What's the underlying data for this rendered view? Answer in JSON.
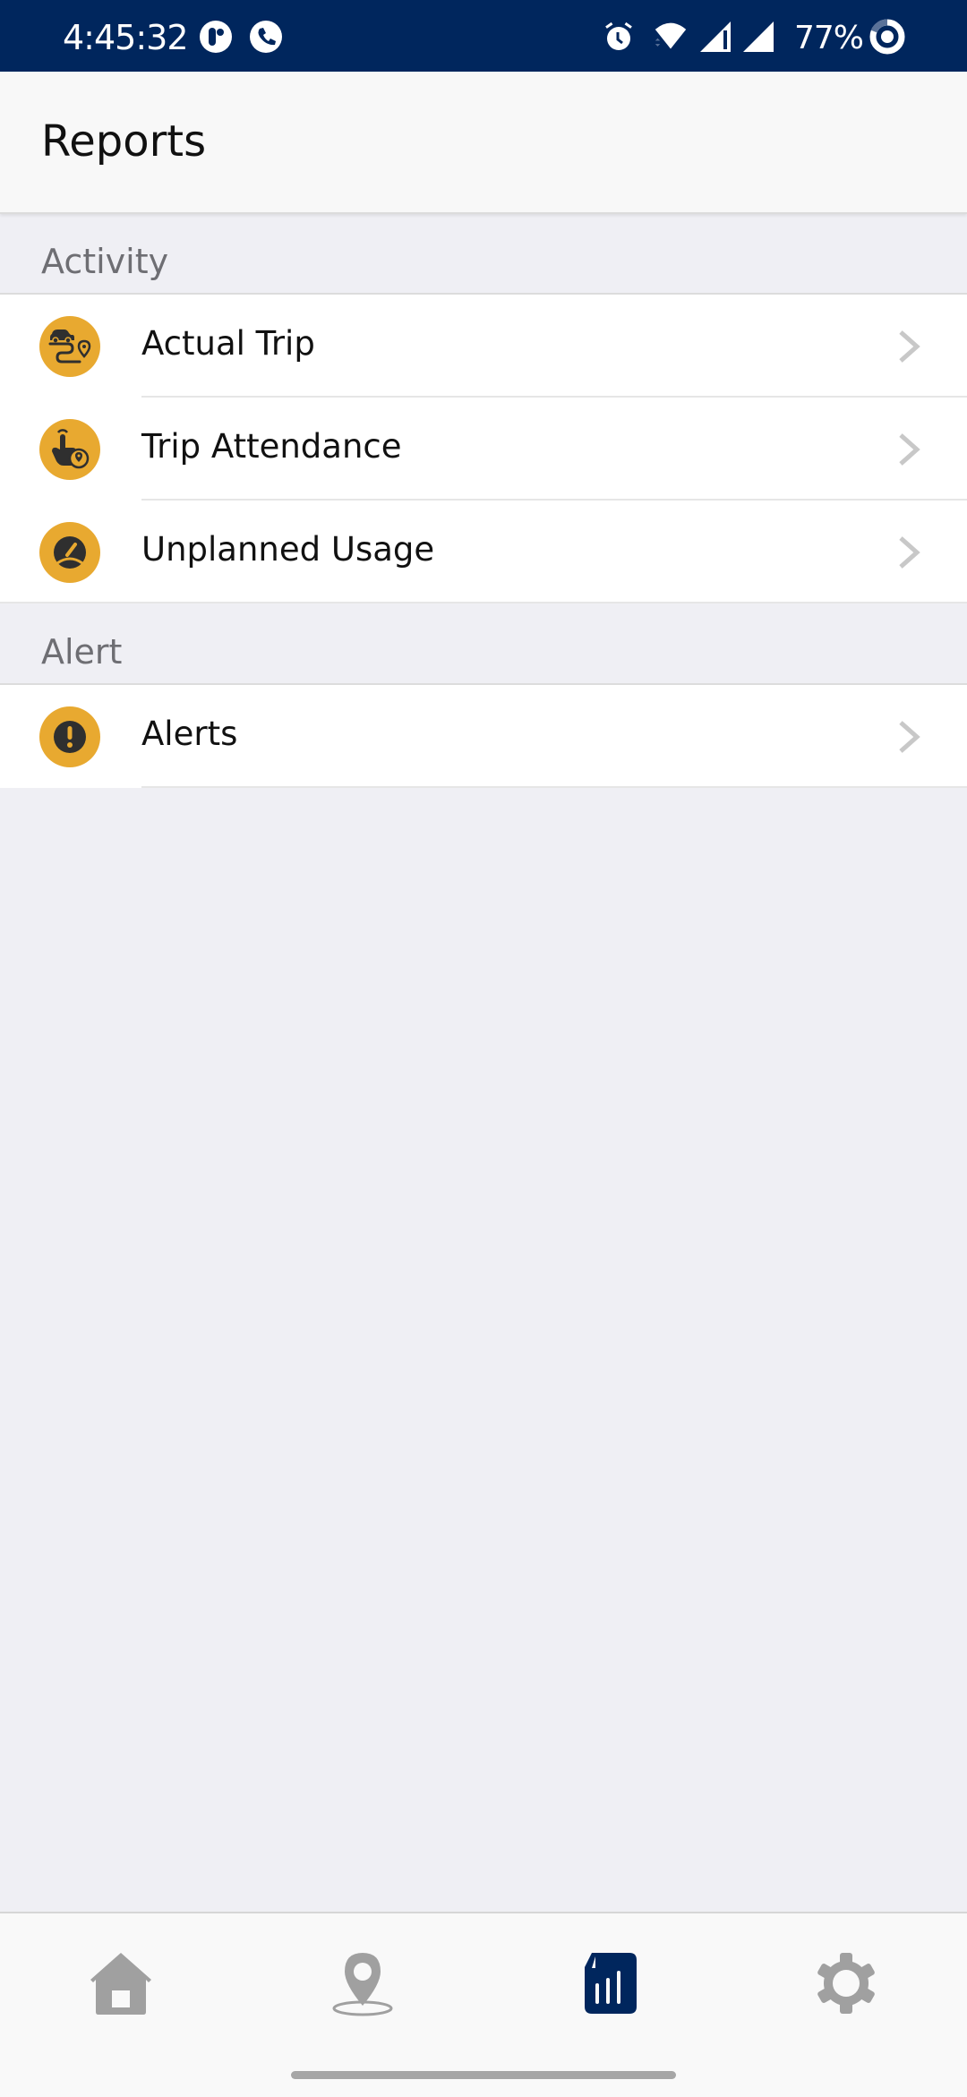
{
  "status_bar": {
    "time": "4:45:32",
    "battery_percent": "77%",
    "left_icons": [
      "app-notification-icon",
      "phone-call-icon"
    ],
    "right_icons": [
      "alarm-icon",
      "wifi-icon",
      "signal-icon",
      "signal-icon",
      "battery-saver-icon"
    ]
  },
  "header": {
    "title": "Reports"
  },
  "sections": [
    {
      "title": "Activity",
      "items": [
        {
          "label": "Actual Trip",
          "icon": "car-route-icon"
        },
        {
          "label": "Trip Attendance",
          "icon": "tap-location-icon"
        },
        {
          "label": "Unplanned Usage",
          "icon": "speedometer-icon"
        }
      ]
    },
    {
      "title": "Alert",
      "items": [
        {
          "label": "Alerts",
          "icon": "exclamation-icon"
        }
      ]
    }
  ],
  "bottom_nav": {
    "items": [
      {
        "name": "home",
        "icon": "home-icon",
        "active": false
      },
      {
        "name": "location",
        "icon": "map-pin-icon",
        "active": false
      },
      {
        "name": "reports",
        "icon": "report-chart-icon",
        "active": true
      },
      {
        "name": "settings",
        "icon": "gear-icon",
        "active": false
      }
    ]
  },
  "colors": {
    "status_bar": "#00265d",
    "accent": "#00265d",
    "icon_badge": "#e8a930",
    "icon_glyph": "#2f2f2f",
    "inactive_nav": "#a0a0a0",
    "section_text": "#6e6e73",
    "background": "#efeff4"
  }
}
